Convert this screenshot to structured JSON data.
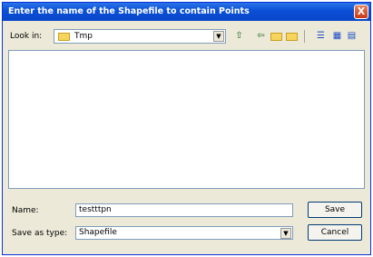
{
  "window": {
    "title": "Enter the name of the Shapefile to contain Points",
    "close": "X"
  },
  "lookin": {
    "label": "Look in:",
    "value": "Tmp",
    "arrow": "▼"
  },
  "toolbar": {
    "up_icon": "up-folder-icon",
    "back_icon": "back-icon",
    "folder_icon": "folder-icon",
    "new_folder_icon": "new-folder-icon",
    "list_icon": "list-view-icon",
    "details_icon": "details-view-icon",
    "thumbs_icon": "thumbnails-view-icon"
  },
  "name": {
    "label": "Name:",
    "value": "testttpn"
  },
  "save_type": {
    "label": "Save as type:",
    "value": "Shapefile",
    "arrow": "▼"
  },
  "buttons": {
    "save": "Save",
    "cancel": "Cancel"
  }
}
